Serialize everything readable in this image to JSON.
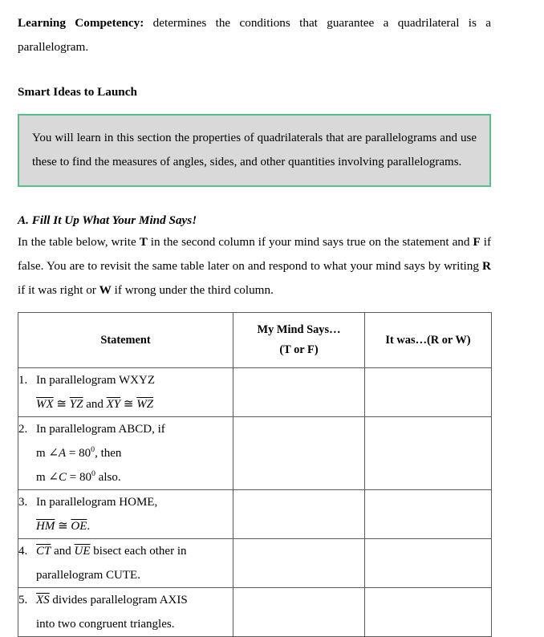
{
  "document": {
    "competency_label": "Learning Competency:",
    "competency_text": " determines the conditions that guarantee a quadrilateral is a parallelogram.",
    "section_heading": "Smart Ideas to Launch",
    "callout_text": "You will learn in this section the properties of quadrilaterals that are parallelograms and use these to find the measures of angles, sides, and other quantities involving parallelograms.",
    "callout_border_color": "#5cbd8c",
    "callout_background_color": "#d9d9d9",
    "activity": {
      "heading": "A. Fill It Up What Your Mind Says!",
      "instructions_part1": "In the table below, write ",
      "instructions_bold1": "T",
      "instructions_part2": " in the second column if your mind says true on the statement and ",
      "instructions_bold2": "F",
      "instructions_part3": " if false. You are to revisit the same table later on and respond to what your mind says by writing ",
      "instructions_bold3": "R",
      "instructions_part4": " if it was right or ",
      "instructions_bold4": "W",
      "instructions_part5": " if wrong under the third column."
    }
  },
  "table": {
    "headers": {
      "statement": "Statement",
      "mind_says_line1": "My Mind Says…",
      "mind_says_line2": "(T or F)",
      "it_was": "It was…(R or W)"
    },
    "rows": [
      {
        "number": "1.",
        "line1": "In parallelogram WXYZ",
        "line2_seg1": "WX",
        "line2_cong1": " ≅ ",
        "line2_seg2": "YZ",
        "line2_mid": " and ",
        "line2_seg3": "XY",
        "line2_cong2": " ≅ ",
        "line2_seg4": "WZ",
        "mind_says": "",
        "it_was": ""
      },
      {
        "number": "2.",
        "line1": "In parallelogram ABCD, if",
        "line2_prefix": "m ∠",
        "line2_var": "A",
        "line2_eq": " = 80",
        "line2_sup": "0",
        "line2_suffix": ", then",
        "line3_prefix": "m ∠",
        "line3_var": "C",
        "line3_eq": " = 80",
        "line3_sup": "0",
        "line3_suffix": " also.",
        "mind_says": "",
        "it_was": ""
      },
      {
        "number": "3.",
        "line1": "In parallelogram HOME,",
        "line2_seg1": "HM",
        "line2_cong1": " ≅ ",
        "line2_seg2": "OE",
        "line2_suffix": ".",
        "mind_says": "",
        "it_was": ""
      },
      {
        "number": "4.",
        "line1_seg1": "CT",
        "line1_mid": " and ",
        "line1_seg2": "UE",
        "line1_suffix": " bisect each other in",
        "line2": "parallelogram CUTE.",
        "mind_says": "",
        "it_was": ""
      },
      {
        "number": "5.",
        "line1_seg1": "XS",
        "line1_suffix": " divides parallelogram AXIS",
        "line2": "into two congruent triangles.",
        "mind_says": "",
        "it_was": ""
      }
    ]
  }
}
